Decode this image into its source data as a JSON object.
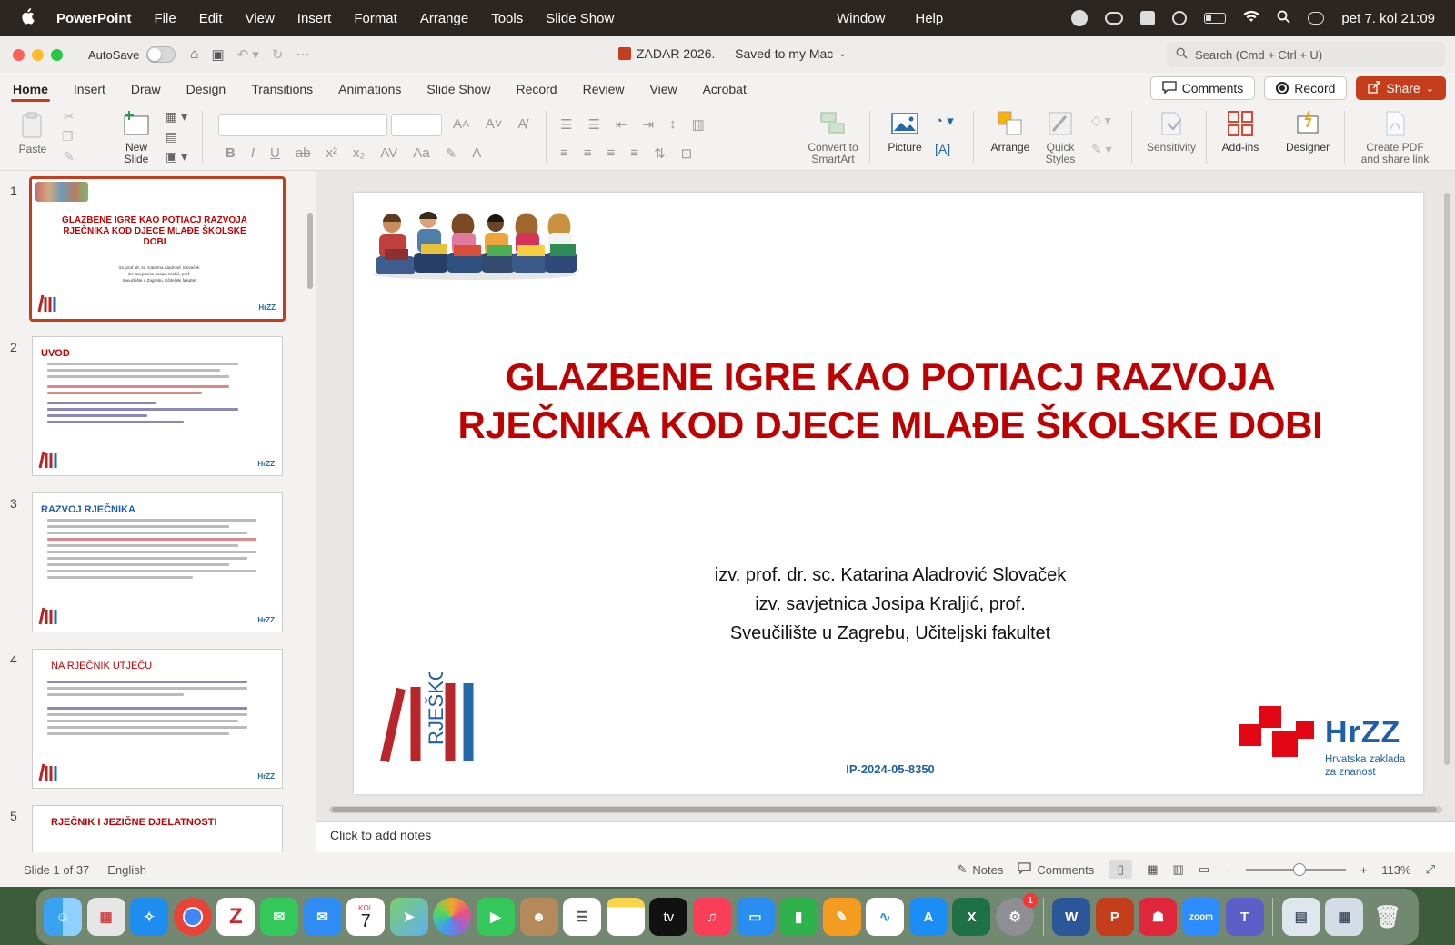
{
  "menubar": {
    "app_name": "PowerPoint",
    "items": [
      "File",
      "Edit",
      "View",
      "Insert",
      "Format",
      "Arrange",
      "Tools",
      "Slide Show"
    ],
    "right_items": [
      "Window",
      "Help"
    ],
    "datetime": "pet 7. kol  21:09"
  },
  "titlebar": {
    "autosave_label": "AutoSave",
    "document_title": "ZADAR 2026. — Saved to my Mac",
    "search_placeholder": "Search (Cmd + Ctrl + U)"
  },
  "ribbon_tabs": [
    "Home",
    "Insert",
    "Draw",
    "Design",
    "Transitions",
    "Animations",
    "Slide Show",
    "Record",
    "Review",
    "View",
    "Acrobat"
  ],
  "tab_buttons": {
    "comments": "Comments",
    "record": "Record",
    "share": "Share"
  },
  "ribbon": {
    "paste": "Paste",
    "new_slide": "New\nSlide",
    "convert_smartart": "Convert to\nSmartArt",
    "picture": "Picture",
    "arrange": "Arrange",
    "quick_styles": "Quick\nStyles",
    "sensitivity": "Sensitivity",
    "addins": "Add-ins",
    "designer": "Designer",
    "create_pdf": "Create PDF\nand share link"
  },
  "thumbnails": [
    {
      "num": "1",
      "title": "GLAZBENE IGRE KAO POTIACJ RAZVOJA RJEČNIKA KOD DJECE MLAĐE ŠKOLSKE DOBI",
      "lines": [
        "izv. prof. dr. sc. Katarina Aladrović Slovaček",
        "izv. savjetnica Josipa Kraljić, prof.",
        "Sveučilište u Zagrebu, Učiteljski fakultet"
      ]
    },
    {
      "num": "2",
      "title": "UVOD"
    },
    {
      "num": "3",
      "title": "RAZVOJ RJEČNIKA"
    },
    {
      "num": "4",
      "title": "NA RJEČNIK UTJEČU"
    },
    {
      "num": "5",
      "title": "RJEČNIK I JEZIČNE DJELATNOSTI"
    }
  ],
  "slide": {
    "title": "GLAZBENE IGRE KAO POTIACJ RAZVOJA RJEČNIKA KOD DJECE MLAĐE ŠKOLSKE DOBI",
    "subtitle_lines": [
      "izv. prof. dr. sc. Katarina Aladrović Slovaček",
      "izv. savjetnica Josipa Kraljić, prof.",
      "Sveučilište u Zagrebu, Učiteljski fakultet"
    ],
    "project_code": "IP-2024-05-8350",
    "logo_left_text": "RJEŠKO",
    "logo_right_text": "HrZZ",
    "logo_right_sub": "Hrvatska zaklada\nza znanost"
  },
  "notes_placeholder": "Click to add notes",
  "status": {
    "slide_count": "Slide 1 of 37",
    "language": "English",
    "notes": "Notes",
    "comments": "Comments",
    "zoom": "113%"
  },
  "dock": {
    "calendar_month": "KOL",
    "calendar_day": "7",
    "badge": "1",
    "tv_label": "tv",
    "zoom_label": "zoom"
  },
  "colors": {
    "accent": "#c43e1c",
    "slide_title": "#c00000",
    "project_code": "#1f5fa8"
  }
}
